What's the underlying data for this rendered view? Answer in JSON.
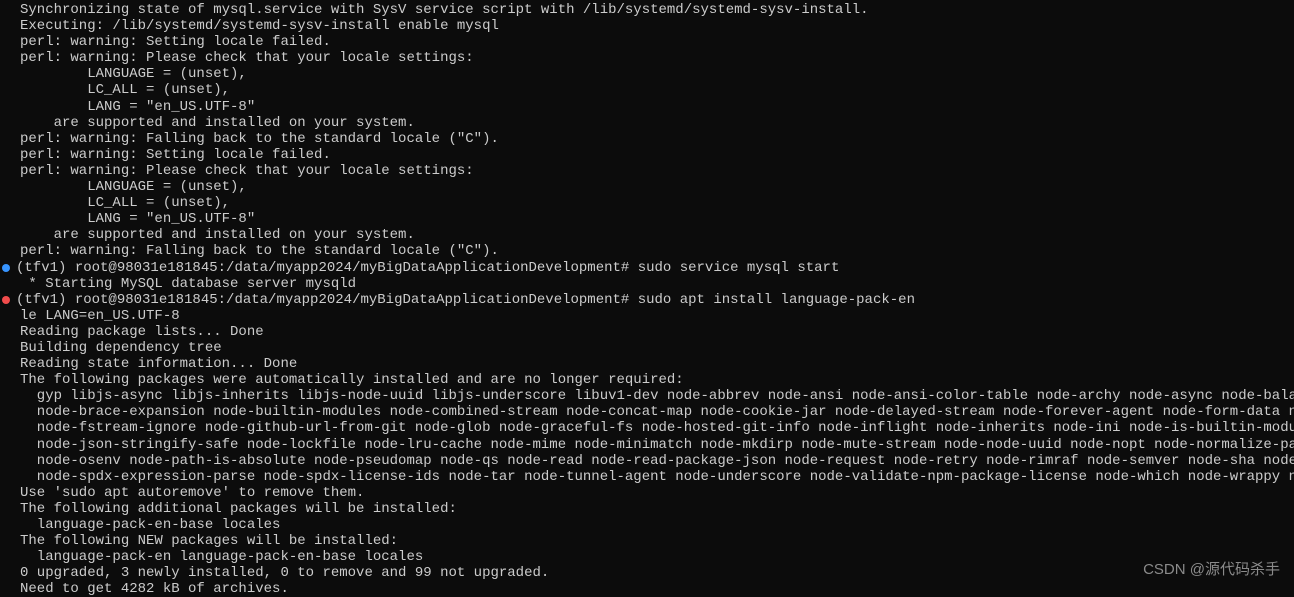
{
  "lines": [
    "Synchronizing state of mysql.service with SysV service script with /lib/systemd/systemd-sysv-install.",
    "Executing: /lib/systemd/systemd-sysv-install enable mysql",
    "perl: warning: Setting locale failed.",
    "perl: warning: Please check that your locale settings:",
    "        LANGUAGE = (unset),",
    "        LC_ALL = (unset),",
    "        LANG = \"en_US.UTF-8\"",
    "    are supported and installed on your system.",
    "perl: warning: Falling back to the standard locale (\"C\").",
    "perl: warning: Setting locale failed.",
    "perl: warning: Please check that your locale settings:",
    "        LANGUAGE = (unset),",
    "        LC_ALL = (unset),",
    "        LANG = \"en_US.UTF-8\"",
    "    are supported and installed on your system.",
    "perl: warning: Falling back to the standard locale (\"C\")."
  ],
  "prompt1": {
    "env": "(tfv1) ",
    "user_host": "root@98031e181845:",
    "path": "/data/myapp2024/myBigDataApplicationDevelopment# ",
    "command": "sudo service mysql start"
  },
  "lines2": [
    " * Starting MySQL database server mysqld"
  ],
  "prompt2": {
    "env": "(tfv1) ",
    "user_host": "root@98031e181845:",
    "path": "/data/myapp2024/myBigDataApplicationDevelopment# ",
    "command": "sudo apt install language-pack-en"
  },
  "lines3": [
    "le LANG=en_US.UTF-8",
    "Reading package lists... Done",
    "Building dependency tree",
    "Reading state information... Done",
    "The following packages were automatically installed and are no longer required:",
    "  gyp libjs-async libjs-inherits libjs-node-uuid libjs-underscore libuv1-dev node-abbrev node-ansi node-ansi-color-table node-archy node-async node-balanced-mat",
    "  node-brace-expansion node-builtin-modules node-combined-stream node-concat-map node-cookie-jar node-delayed-stream node-forever-agent node-form-data node-fs.",
    "  node-fstream-ignore node-github-url-from-git node-glob node-graceful-fs node-hosted-git-info node-inflight node-inherits node-ini node-is-builtin-module node",
    "  node-json-stringify-safe node-lockfile node-lru-cache node-mime node-minimatch node-mkdirp node-mute-stream node-node-uuid node-nopt node-normalize-package-da",
    "  node-osenv node-path-is-absolute node-pseudomap node-qs node-read node-read-package-json node-request node-retry node-rimraf node-semver node-sha node-slide n",
    "  node-spdx-expression-parse node-spdx-license-ids node-tar node-tunnel-agent node-underscore node-validate-npm-package-license node-which node-wrappy node-yal",
    "Use 'sudo apt autoremove' to remove them.",
    "The following additional packages will be installed:",
    "  language-pack-en-base locales",
    "The following NEW packages will be installed:",
    "  language-pack-en language-pack-en-base locales",
    "0 upgraded, 3 newly installed, 0 to remove and 99 not upgraded.",
    "Need to get 4282 kB of archives."
  ],
  "watermark": "CSDN @源代码杀手"
}
